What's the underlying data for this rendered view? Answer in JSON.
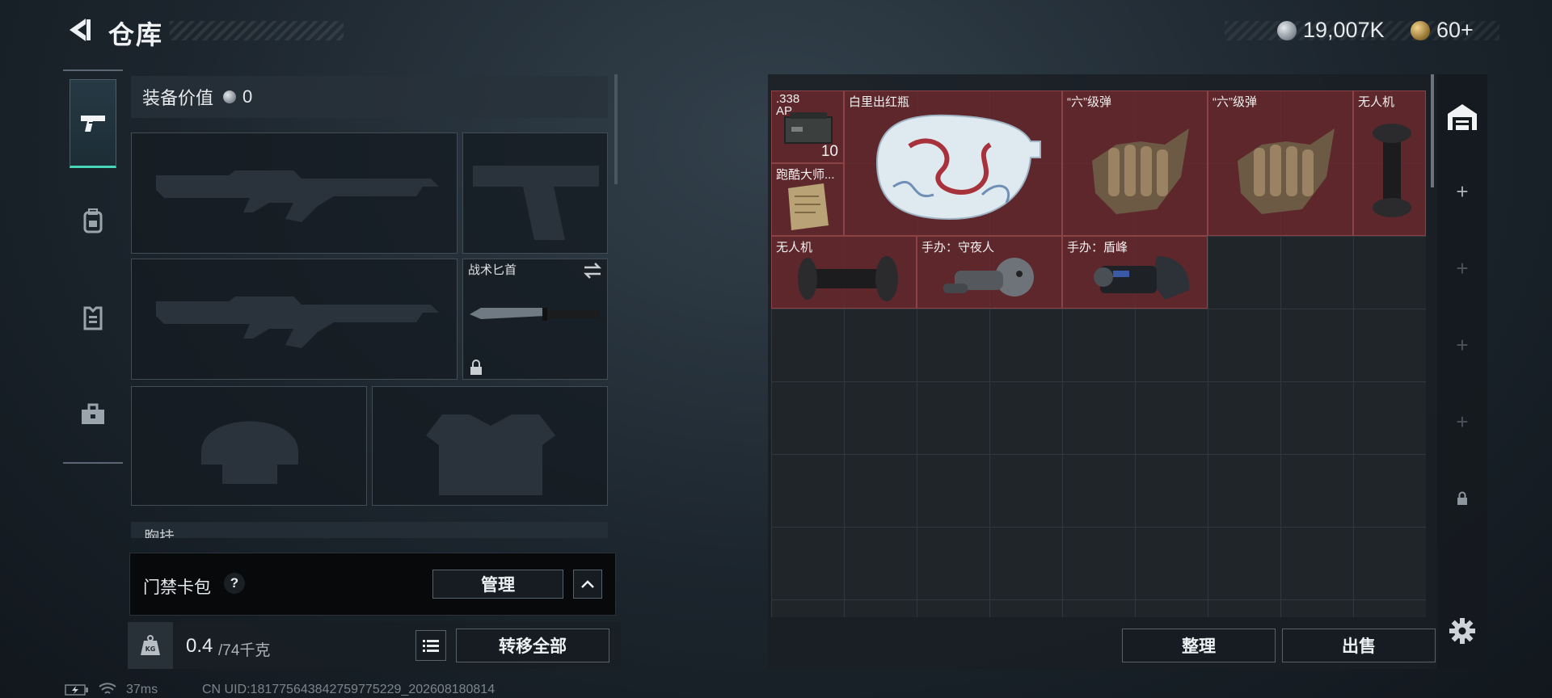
{
  "header": {
    "title": "仓库"
  },
  "currency": [
    {
      "icon": "silver-coin-icon",
      "value": "19,007K"
    },
    {
      "icon": "gold-coin-icon",
      "value": "60+"
    }
  ],
  "categories": [
    {
      "icon": "pistol-icon",
      "active": true
    },
    {
      "icon": "backpack-icon",
      "active": false
    },
    {
      "icon": "vest-icon",
      "active": false
    },
    {
      "icon": "toolbox-icon",
      "active": false
    }
  ],
  "loadout": {
    "value_label": "装备价值",
    "value": "0",
    "melee_slot": {
      "label": "战术匕首",
      "swap_icon": "swap-icon",
      "lock_icon": "lock-icon"
    },
    "chest_rig_label": "胸挂"
  },
  "keycard": {
    "label": "门禁卡包",
    "help": "?",
    "manage_label": "管理"
  },
  "capacity": {
    "current": "0.4",
    "max": "/74千克",
    "weight_icon": "kg-weight-icon"
  },
  "transfer_all_label": "转移全部",
  "stash_items": [
    {
      "id": "ammo",
      "label": ".338 AP",
      "count": "10"
    },
    {
      "id": "vase",
      "label": "白里出红瓶"
    },
    {
      "id": "ammo6a",
      "label": "“六”级弹"
    },
    {
      "id": "ammo6b",
      "label": "“六”级弹"
    },
    {
      "id": "drone1",
      "label": "无人机"
    },
    {
      "id": "doc",
      "label": "跑酷大师..."
    },
    {
      "id": "drone2",
      "label": "无人机"
    },
    {
      "id": "fig1",
      "label": "手办：守夜人"
    },
    {
      "id": "fig2",
      "label": "手办：盾峰"
    }
  ],
  "sidebar": {
    "plus": "+"
  },
  "actions": {
    "sort_label": "整理",
    "sell_label": "出售"
  },
  "footer": {
    "ping": "37ms",
    "uid": "CN UID:181775643842759775229_202608180814"
  },
  "colors": {
    "accent": "#47d6b8",
    "item_bg": "#75282c"
  }
}
